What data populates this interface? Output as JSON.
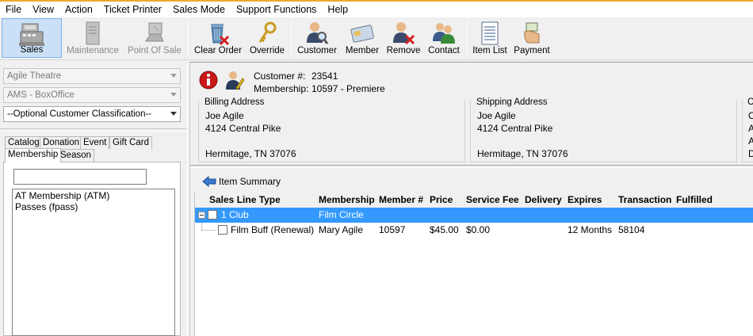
{
  "menu": [
    "File",
    "View",
    "Action",
    "Ticket Printer",
    "Sales Mode",
    "Support Functions",
    "Help"
  ],
  "toolbar": {
    "sales": "Sales",
    "maintenance": "Maintenance",
    "point_of_sale": "Point Of Sale",
    "clear_order": "Clear Order",
    "override": "Override",
    "customer": "Customer",
    "member": "Member",
    "remove": "Remove",
    "contact": "Contact",
    "item_list": "Item List",
    "payment": "Payment"
  },
  "left": {
    "organization": "Agile Theatre",
    "location": "AMS - BoxOffice",
    "classification": "--Optional Customer Classification--",
    "tabs_row1": [
      "Catalog",
      "Donation",
      "Event",
      "Gift Card"
    ],
    "tabs_row2": [
      "Membership",
      "Season"
    ],
    "search_value": "",
    "items": [
      "AT Membership  (ATM)",
      "Passes  (fpass)"
    ]
  },
  "customer": {
    "number_label": "Customer #:",
    "number": "23541",
    "membership_label": "Membership:",
    "membership": "10597 - Premiere",
    "billing": {
      "title": "Billing Address",
      "name": "Joe Agile",
      "street": "4124 Central Pike",
      "city": "Hermitage, TN 37076"
    },
    "shipping": {
      "title": "Shipping Address",
      "name": "Joe Agile",
      "street": "4124 Central Pike",
      "city": "Hermitage, TN 37076"
    },
    "third_panel": {
      "title": "C",
      "lines": [
        "C",
        "A",
        "A",
        "D"
      ]
    }
  },
  "items": {
    "title": "Item Summary",
    "columns": [
      "Sales Line Type",
      "Membership",
      "Member #",
      "Price",
      "Service Fee",
      "Delivery",
      "Expires",
      "Transaction",
      "Fulfilled"
    ],
    "group": {
      "type": "1 Club",
      "membership": "Film Circle"
    },
    "row": {
      "type": "Film Buff (Renewal)",
      "membership": "Mary Agile",
      "member_no": "10597",
      "price": "$45.00",
      "service_fee": "$0.00",
      "delivery": "",
      "expires": "12 Months",
      "transaction": "58104",
      "fulfilled": ""
    }
  },
  "colors": {
    "selection": "#3399ff",
    "active_tool": "#c9e0f7",
    "accent_line": "#f0a830"
  }
}
